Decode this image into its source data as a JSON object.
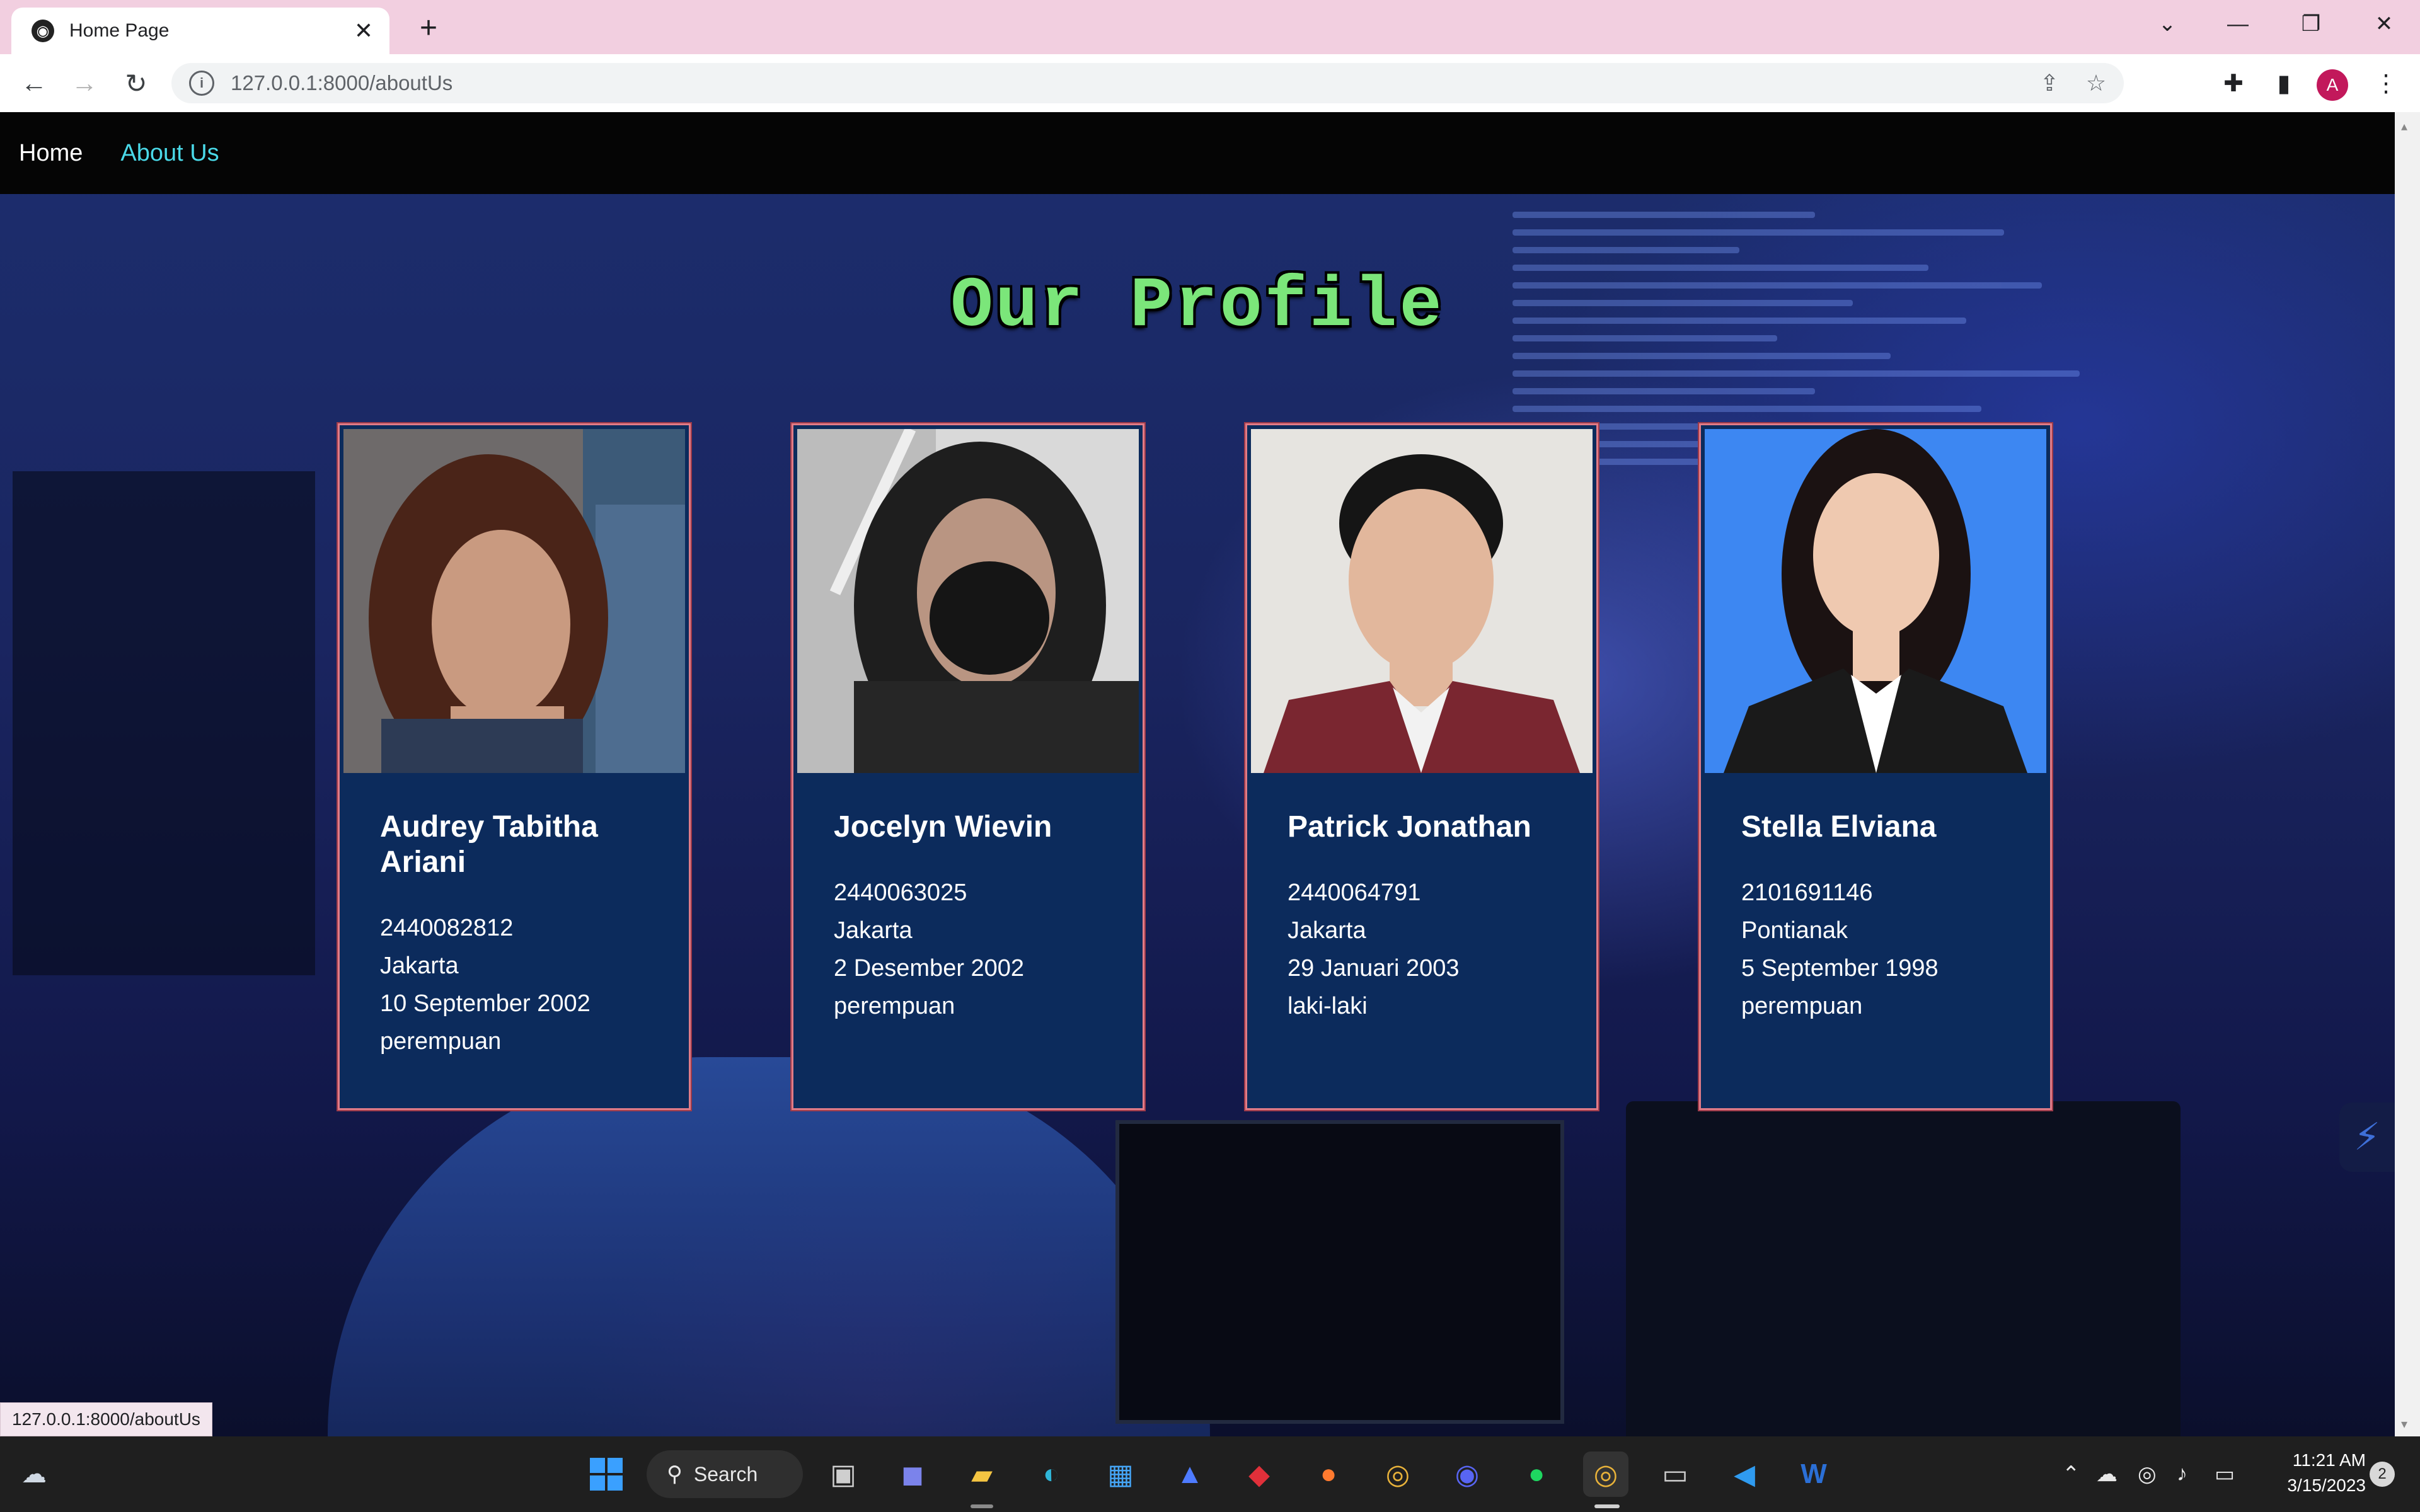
{
  "browser": {
    "tab_title": "Home Page",
    "url": "127.0.0.1:8000/aboutUs",
    "status_url": "127.0.0.1:8000/aboutUs",
    "avatar_letter": "A"
  },
  "site_nav": {
    "home": "Home",
    "about": "About Us"
  },
  "heading": "Our Profile",
  "profiles": [
    {
      "name": "Audrey Tabitha Ariani",
      "id": "2440082812",
      "city": "Jakarta",
      "birthdate": "10 September 2002",
      "gender": "perempuan"
    },
    {
      "name": "Jocelyn Wievin",
      "id": "2440063025",
      "city": "Jakarta",
      "birthdate": "2 Desember 2002",
      "gender": "perempuan"
    },
    {
      "name": "Patrick Jonathan",
      "id": "2440064791",
      "city": "Jakarta",
      "birthdate": "29 Januari 2003",
      "gender": "laki-laki"
    },
    {
      "name": "Stella Elviana",
      "id": "2101691146",
      "city": "Pontianak",
      "birthdate": "5 September 1998",
      "gender": "perempuan"
    }
  ],
  "taskbar": {
    "search_label": "Search",
    "time": "11:21 AM",
    "date": "3/15/2023",
    "notifications": "2"
  },
  "colors": {
    "heading": "#7be67a",
    "nav_active": "#4ad9e8",
    "card_bg": "#0c2b5c",
    "card_border": "#e07b87",
    "titlebar": "#f2cfe0"
  }
}
